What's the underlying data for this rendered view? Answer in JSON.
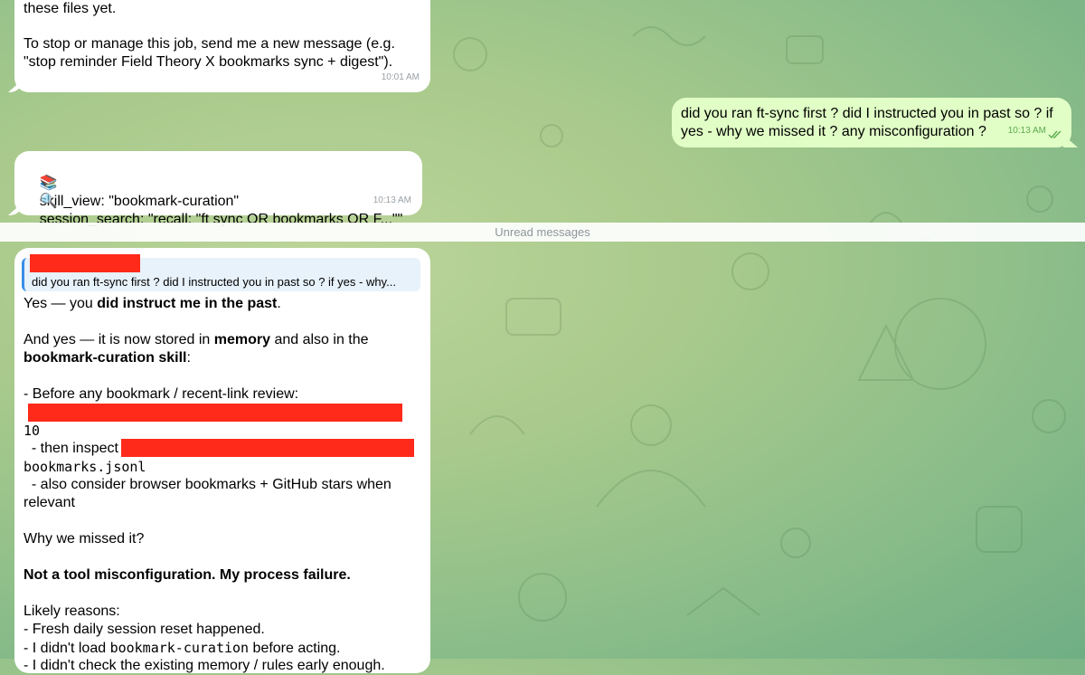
{
  "colors": {
    "incoming": "#ffffff",
    "outgoing": "#e1fec6",
    "redaction": "#ff2a1a",
    "reply_bar": "#3a8ee6"
  },
  "msg1": {
    "line1": "these files yet.",
    "line2": "To stop or manage this job, send me a new message (e.g.",
    "line3": "\"stop reminder Field Theory X bookmarks sync + digest\").",
    "time": "10:01 AM"
  },
  "msg2": {
    "line1": "did you ran ft-sync first ? did I instructed you in past so ? if",
    "line2": "yes - why we missed it ? any misconfiguration ?",
    "time": "10:13 AM",
    "status_icon": "double-check-icon"
  },
  "msg3": {
    "line1_icon": "📚",
    "line1": "skill_view: \"bookmark-curation\"",
    "line2_icon": "🔍",
    "line2": "session_search: \"recall: \"ft sync OR bookmarks OR F...\"\"",
    "time": "10:13 AM"
  },
  "divider": {
    "label": "Unread messages"
  },
  "msg4": {
    "reply_quote": "did you ran ft-sync first ? did I instructed you in past so ? if yes - why...",
    "p1_a": "Yes — you ",
    "p1_b": "did instruct me in the past",
    "p1_c": ".",
    "p2_a": "And yes — it is now stored in ",
    "p2_b": "memory",
    "p2_c": " and also in the",
    "p3_a": "bookmark-curation skill",
    "p3_b": ":",
    "l_before": "- Before any bookmark / recent-link review:",
    "l_10": "10",
    "l_inspect": "  - then inspect",
    "l_jsonl": "bookmarks.jsonl",
    "l_consider": "  - also consider browser bookmarks + GitHub stars when",
    "l_relevant": "relevant",
    "l_why": "Why we missed it?",
    "l_not": "Not a tool misconfiguration. My process failure.",
    "l_likely": "Likely reasons:",
    "l_fresh": "- Fresh daily session reset happened.",
    "l_load_a": "- I didn't load ",
    "l_load_b": "bookmark-curation",
    "l_load_c": " before acting.",
    "l_cut": "- I didn't check the existing memory / rules early enough."
  }
}
